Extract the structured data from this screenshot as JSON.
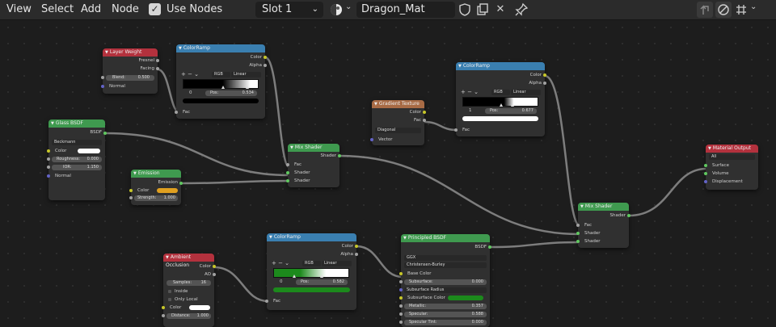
{
  "header": {
    "menus": [
      "View",
      "Select",
      "Add",
      "Node"
    ],
    "use_nodes_label": "Use Nodes",
    "slot": "Slot 1",
    "material_name": "Dragon_Mat"
  },
  "colors": {
    "header_red": "#b3313d",
    "header_blue": "#3a7fb0",
    "header_green": "#3f9a4f",
    "header_tan": "#a86b45",
    "socket_shader": "#60c860",
    "socket_color": "#c7c729",
    "socket_float": "#a1a1a1",
    "socket_vector": "#6363c7"
  },
  "nodes": {
    "layer_weight": {
      "title": "Layer Weight",
      "out_fresnel": "Fresnel",
      "out_facing": "Facing",
      "blend_label": "Blend:",
      "blend_value": "0.500",
      "in_normal": "Normal"
    },
    "colorramp1": {
      "title": "ColorRamp",
      "out_color": "Color",
      "out_alpha": "Alpha",
      "mode": "RGB",
      "interp": "Linear",
      "index": "0",
      "pos_label": "Pos:",
      "pos_value": "0.534",
      "in_fac": "Fac"
    },
    "glass": {
      "title": "Glass BSDF",
      "out_bsdf": "BSDF",
      "distribution": "Beckmann",
      "in_color": "Color",
      "roughness_label": "Roughness:",
      "roughness_value": "0.000",
      "ior_label": "IOR:",
      "ior_value": "1.150",
      "in_normal": "Normal"
    },
    "emission": {
      "title": "Emission",
      "out_emission": "Emission",
      "in_color": "Color",
      "strength_label": "Strength:",
      "strength_value": "1.000"
    },
    "mix1": {
      "title": "Mix Shader",
      "out_shader": "Shader",
      "in_fac": "Fac",
      "in_shader1": "Shader",
      "in_shader2": "Shader"
    },
    "gradient": {
      "title": "Gradient Texture",
      "out_color": "Color",
      "out_fac": "Fac",
      "type": "Diagonal",
      "in_vector": "Vector"
    },
    "colorramp2": {
      "title": "ColorRamp",
      "out_color": "Color",
      "out_alpha": "Alpha",
      "mode": "RGB",
      "interp": "Linear",
      "index": "1",
      "pos_label": "Pos:",
      "pos_value": "0.677",
      "in_fac": "Fac"
    },
    "material_output": {
      "title": "Material Output",
      "target": "All",
      "in_surface": "Surface",
      "in_volume": "Volume",
      "in_displacement": "Displacement"
    },
    "mix2": {
      "title": "Mix Shader",
      "out_shader": "Shader",
      "in_fac": "Fac",
      "in_shader1": "Shader",
      "in_shader2": "Shader"
    },
    "ao": {
      "title": "Ambient Occlusion",
      "out_color": "Color",
      "out_ao": "AO",
      "samples_label": "Samples:",
      "samples_value": "16",
      "inside_label": "Inside",
      "only_local_label": "Only Local",
      "in_color": "Color",
      "distance_label": "Distance:",
      "distance_value": "1.000"
    },
    "colorramp3": {
      "title": "ColorRamp",
      "out_color": "Color",
      "out_alpha": "Alpha",
      "mode": "RGB",
      "interp": "Linear",
      "index": "0",
      "pos_label": "Pos:",
      "pos_value": "0.582",
      "in_fac": "Fac"
    },
    "principled": {
      "title": "Principled BSDF",
      "out_bsdf": "BSDF",
      "distribution": "GGX",
      "subsurface_method": "Christensen-Burley",
      "in_base_color": "Base Color",
      "subsurface_label": "Subsurface:",
      "subsurface_value": "0.000",
      "subsurface_radius": "Subsurface Radius",
      "subsurface_color": "Subsurface Color",
      "metallic_label": "Metallic:",
      "metallic_value": "0.357",
      "specular_label": "Specular:",
      "specular_value": "0.588",
      "specular_tint_label": "Specular Tint:",
      "specular_tint_value": "0.000"
    }
  }
}
